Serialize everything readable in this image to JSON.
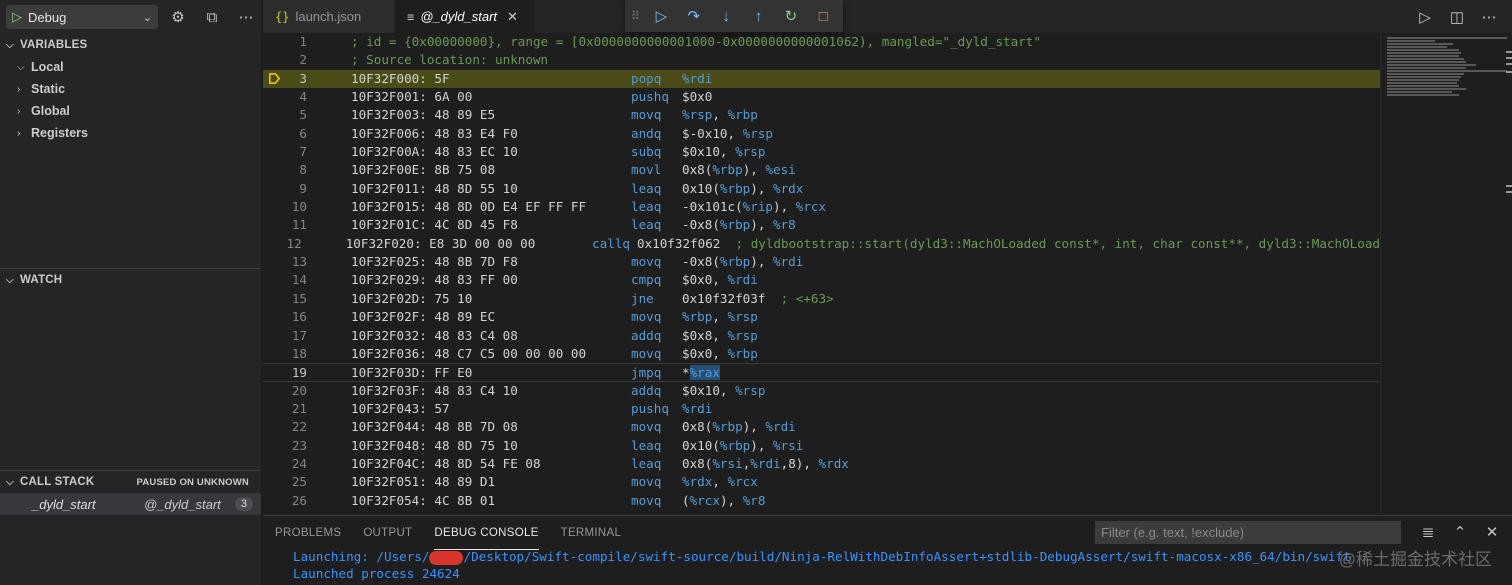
{
  "debug_toolbar": {
    "config_name": "Debug",
    "icons": [
      "play-icon",
      "gear-icon",
      "open-terminal-icon",
      "more-icon"
    ]
  },
  "sidebar": {
    "variables": {
      "title": "VARIABLES",
      "items": [
        {
          "label": "Local",
          "expanded": true
        },
        {
          "label": "Static",
          "expanded": false
        },
        {
          "label": "Global",
          "expanded": false
        },
        {
          "label": "Registers",
          "expanded": false
        }
      ]
    },
    "watch": {
      "title": "WATCH"
    },
    "call_stack": {
      "title": "CALL STACK",
      "status": "PAUSED ON UNKNOWN",
      "frame": {
        "name": "_dyld_start",
        "source": "@_dyld_start",
        "badge": "3"
      }
    }
  },
  "tabs": [
    {
      "icon": "{}",
      "label": "launch.json",
      "active": false
    },
    {
      "icon": "≡",
      "label": "@_dyld_start",
      "active": true
    }
  ],
  "editor": {
    "current_line": 3,
    "lines": [
      {
        "n": "1",
        "comment": "; id = {0x00000000}, range = [0x0000000000001000-0x0000000000001062), mangled=\"_dyld_start\""
      },
      {
        "n": "2",
        "comment": "; Source location: unknown"
      },
      {
        "n": "3",
        "addr": "10F32F000: 5F",
        "mnemonic": "popq",
        "operands": "%rdi"
      },
      {
        "n": "4",
        "addr": "10F32F001: 6A 00",
        "mnemonic": "pushq",
        "operands": "$0x0"
      },
      {
        "n": "5",
        "addr": "10F32F003: 48 89 E5",
        "mnemonic": "movq",
        "operands": "%rsp, %rbp"
      },
      {
        "n": "6",
        "addr": "10F32F006: 48 83 E4 F0",
        "mnemonic": "andq",
        "operands": "$-0x10, %rsp"
      },
      {
        "n": "7",
        "addr": "10F32F00A: 48 83 EC 10",
        "mnemonic": "subq",
        "operands": "$0x10, %rsp"
      },
      {
        "n": "8",
        "addr": "10F32F00E: 8B 75 08",
        "mnemonic": "movl",
        "operands": "0x8(%rbp), %esi"
      },
      {
        "n": "9",
        "addr": "10F32F011: 48 8D 55 10",
        "mnemonic": "leaq",
        "operands": "0x10(%rbp), %rdx"
      },
      {
        "n": "10",
        "addr": "10F32F015: 48 8D 0D E4 EF FF FF",
        "mnemonic": "leaq",
        "operands": "-0x101c(%rip), %rcx"
      },
      {
        "n": "11",
        "addr": "10F32F01C: 4C 8D 45 F8",
        "mnemonic": "leaq",
        "operands": "-0x8(%rbp), %r8"
      },
      {
        "n": "12",
        "addr": "10F32F020: E8 3D 00 00 00",
        "mnemonic": "callq",
        "operands": "0x10f32f062",
        "trail": "  ; dyldbootstrap::start(dyld3::MachOLoaded const*, int, char const**, dyld3::MachOLoad"
      },
      {
        "n": "13",
        "addr": "10F32F025: 48 8B 7D F8",
        "mnemonic": "movq",
        "operands": "-0x8(%rbp), %rdi"
      },
      {
        "n": "14",
        "addr": "10F32F029: 48 83 FF 00",
        "mnemonic": "cmpq",
        "operands": "$0x0, %rdi"
      },
      {
        "n": "15",
        "addr": "10F32F02D: 75 10",
        "mnemonic": "jne",
        "operands": "0x10f32f03f",
        "trail": "  ; <+63>"
      },
      {
        "n": "16",
        "addr": "10F32F02F: 48 89 EC",
        "mnemonic": "movq",
        "operands": "%rbp, %rsp"
      },
      {
        "n": "17",
        "addr": "10F32F032: 48 83 C4 08",
        "mnemonic": "addq",
        "operands": "$0x8, %rsp"
      },
      {
        "n": "18",
        "addr": "10F32F036: 48 C7 C5 00 00 00 00",
        "mnemonic": "movq",
        "operands": "$0x0, %rbp"
      },
      {
        "n": "19",
        "addr": "10F32F03D: FF E0",
        "mnemonic": "jmpq",
        "operands": "*%rax"
      },
      {
        "n": "20",
        "addr": "10F32F03F: 48 83 C4 10",
        "mnemonic": "addq",
        "operands": "$0x10, %rsp"
      },
      {
        "n": "21",
        "addr": "10F32F043: 57",
        "mnemonic": "pushq",
        "operands": "%rdi"
      },
      {
        "n": "22",
        "addr": "10F32F044: 48 8B 7D 08",
        "mnemonic": "movq",
        "operands": "0x8(%rbp), %rdi"
      },
      {
        "n": "23",
        "addr": "10F32F048: 48 8D 75 10",
        "mnemonic": "leaq",
        "operands": "0x10(%rbp), %rsi"
      },
      {
        "n": "24",
        "addr": "10F32F04C: 48 8D 54 FE 08",
        "mnemonic": "leaq",
        "operands": "0x8(%rsi,%rdi,8), %rdx"
      },
      {
        "n": "25",
        "addr": "10F32F051: 48 89 D1",
        "mnemonic": "movq",
        "operands": "%rdx, %rcx"
      },
      {
        "n": "26",
        "addr": "10F32F054: 4C 8B 01",
        "mnemonic": "movq",
        "operands": "(%rcx), %r8"
      }
    ]
  },
  "panel": {
    "tabs": [
      {
        "label": "PROBLEMS",
        "active": false
      },
      {
        "label": "OUTPUT",
        "active": false
      },
      {
        "label": "DEBUG CONSOLE",
        "active": true
      },
      {
        "label": "TERMINAL",
        "active": false
      }
    ],
    "filter_placeholder": "Filter (e.g. text, !exclude)",
    "console": {
      "line1_prefix": "Launching: /Users/",
      "line1_suffix": "/Desktop/Swift-compile/swift-source/build/Ninja-RelWithDebInfoAssert+stdlib-DebugAssert/swift-macosx-x86_64/bin/swift",
      "line2": "Launched process 24624"
    },
    "watermark": "@稀土掘金技术社区"
  },
  "colors": {
    "current_line_bg": "#4b4b18",
    "mnemonic": "#569cd6",
    "comment": "#6a9955",
    "console_text": "#3794ff",
    "breakpoint_arrow": "#ffcc00"
  }
}
